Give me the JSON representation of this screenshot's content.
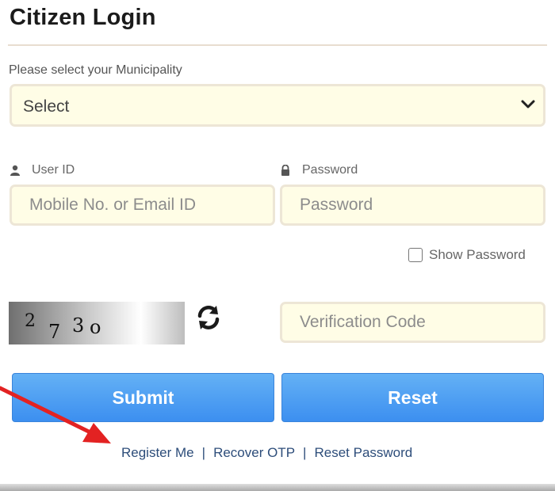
{
  "title": "Citizen Login",
  "municipality": {
    "label": "Please select your Municipality",
    "selected": "Select"
  },
  "user_id": {
    "label": "User ID",
    "placeholder": "Mobile No. or Email ID",
    "value": ""
  },
  "password": {
    "label": "Password",
    "placeholder": "Password",
    "value": ""
  },
  "show_password": {
    "label": "Show Password",
    "checked": false
  },
  "captcha": {
    "text": "2 7 3o"
  },
  "verification": {
    "placeholder": "Verification Code",
    "value": ""
  },
  "buttons": {
    "submit": "Submit",
    "reset": "Reset"
  },
  "links": {
    "register": "Register Me",
    "recover": "Recover OTP",
    "reset_password": "Reset Password",
    "separator": "|"
  },
  "colors": {
    "button_blue": "#4a9bf2",
    "input_bg": "#fffde6",
    "arrow_red": "#e32222"
  },
  "icons": {
    "user": "user-icon",
    "lock": "lock-icon",
    "refresh": "refresh-icon",
    "dropdown": "chevron-down-icon"
  }
}
